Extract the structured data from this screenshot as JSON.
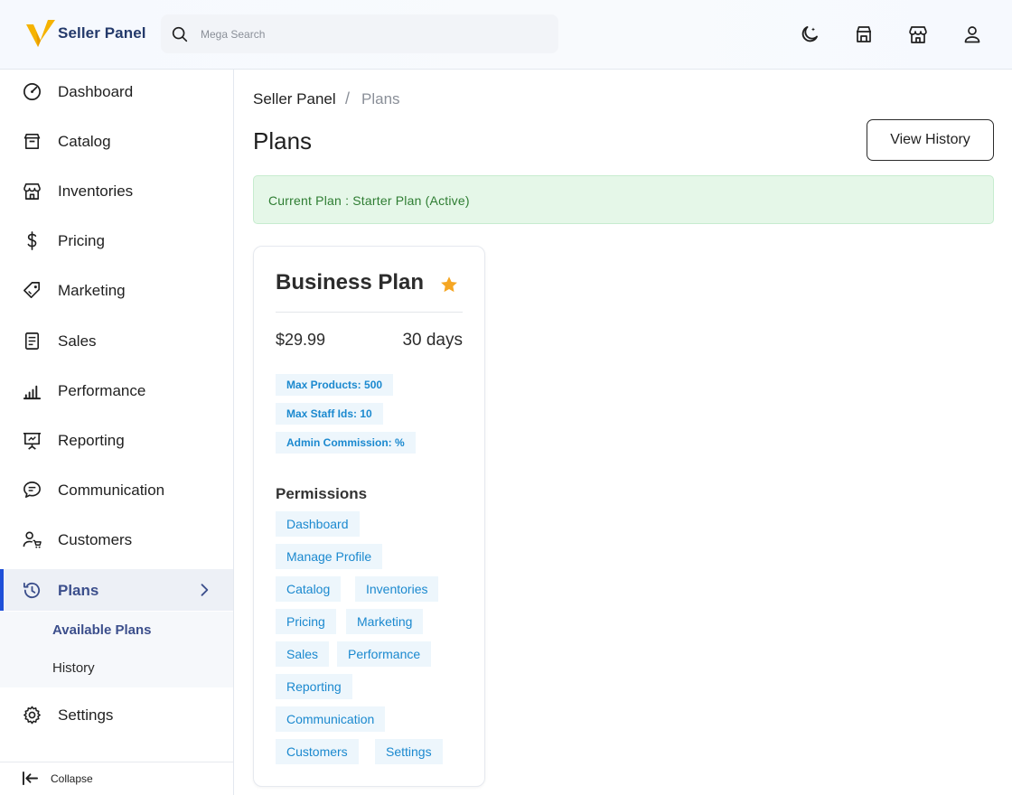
{
  "header": {
    "brand": "Seller Panel",
    "search_placeholder": "Mega Search",
    "icons": [
      "moon-icon",
      "store-icon",
      "shop-icon",
      "user-icon"
    ]
  },
  "sidebar": {
    "items": [
      {
        "label": "Dashboard",
        "icon": "dashboard-icon"
      },
      {
        "label": "Catalog",
        "icon": "catalog-icon"
      },
      {
        "label": "Inventories",
        "icon": "inventories-icon"
      },
      {
        "label": "Pricing",
        "icon": "dollar-icon"
      },
      {
        "label": "Marketing",
        "icon": "tag-icon"
      },
      {
        "label": "Sales",
        "icon": "receipt-icon"
      },
      {
        "label": "Performance",
        "icon": "bars-icon"
      },
      {
        "label": "Reporting",
        "icon": "presentation-icon"
      },
      {
        "label": "Communication",
        "icon": "message-icon"
      },
      {
        "label": "Customers",
        "icon": "customers-icon"
      },
      {
        "label": "Plans",
        "icon": "history-icon",
        "active": true
      },
      {
        "label": "Settings",
        "icon": "gear-icon"
      }
    ],
    "sub_items": [
      {
        "label": "Available Plans",
        "active": true
      },
      {
        "label": "History"
      }
    ],
    "collapse_label": "Collapse"
  },
  "breadcrumb": {
    "root": "Seller Panel",
    "separator": "/",
    "current": "Plans"
  },
  "page": {
    "title": "Plans",
    "view_history_label": "View History",
    "current_plan_alert": "Current Plan : Starter Plan (Active)"
  },
  "plan": {
    "name": "Business Plan",
    "price": "$29.99",
    "duration": "30 days",
    "limits": [
      "Max Products: 500",
      "Max Staff Ids: 10",
      "Admin Commission: %"
    ],
    "permissions_title": "Permissions",
    "permissions": [
      "Dashboard",
      "Manage Profile",
      "Catalog",
      "Inventories",
      "Pricing",
      "Marketing",
      "Sales",
      "Performance",
      "Reporting",
      "Communication",
      "Customers",
      "Settings"
    ]
  },
  "colors": {
    "accent": "#1e4fd8",
    "brand_text": "#243a6b",
    "alert_bg": "#e5f7e8",
    "alert_text": "#2e7d32",
    "badge_bg": "#edf6fc",
    "badge_text": "#1b89cf",
    "star": "#f5a623"
  }
}
